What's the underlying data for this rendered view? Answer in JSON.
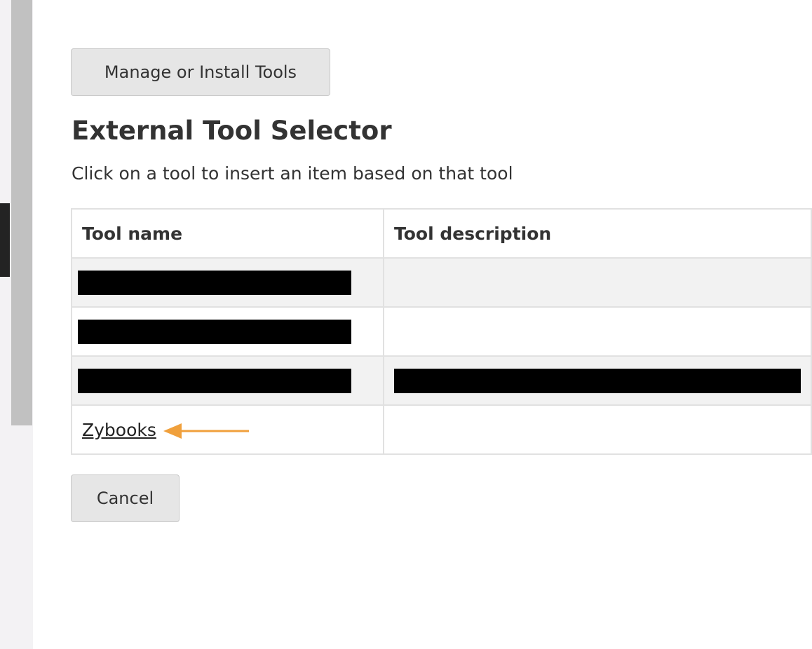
{
  "toolbar": {
    "manage_label": "Manage or Install Tools"
  },
  "heading": {
    "title": "External Tool Selector",
    "subtitle": "Click on a tool to insert an item based on that tool"
  },
  "table": {
    "headers": {
      "name": "Tool name",
      "description": "Tool description"
    },
    "rows": [
      {
        "name": "",
        "description": "",
        "redacted_name": true,
        "redacted_description": false
      },
      {
        "name": "",
        "description": "",
        "redacted_name": true,
        "redacted_description": false
      },
      {
        "name": "",
        "description": "",
        "redacted_name": true,
        "redacted_description": true
      },
      {
        "name": "Zybooks",
        "description": ""
      }
    ]
  },
  "footer": {
    "cancel_label": "Cancel"
  },
  "colors": {
    "arrow": "#f0a03c",
    "button_bg": "#e6e6e6",
    "row_shade": "#f2f2f2"
  },
  "icons": {
    "annotation": "arrow-left-icon"
  }
}
